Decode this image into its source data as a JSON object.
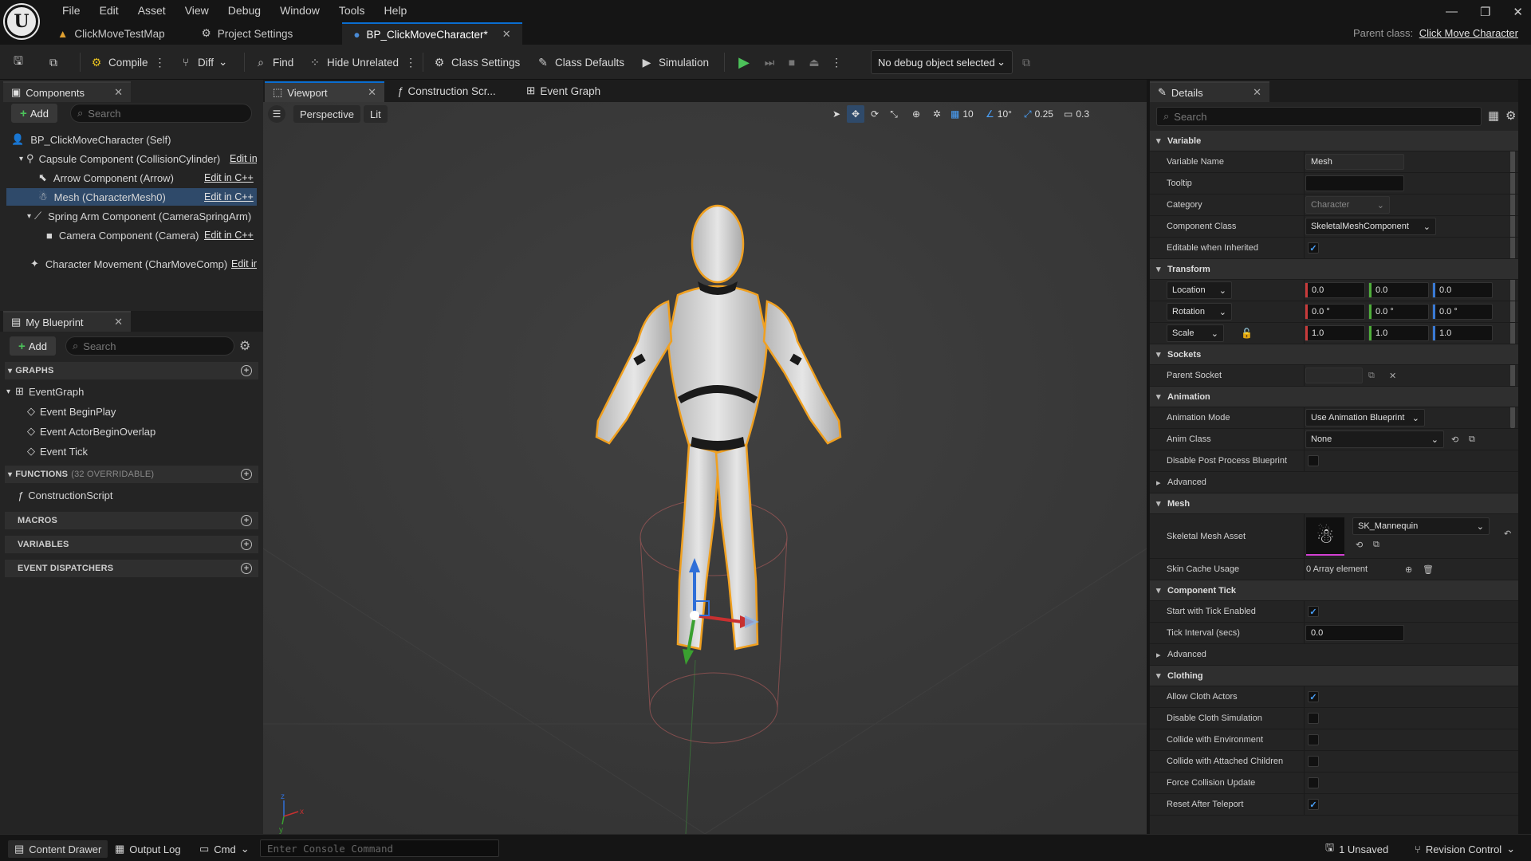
{
  "menu": [
    "File",
    "Edit",
    "Asset",
    "View",
    "Debug",
    "Window",
    "Tools",
    "Help"
  ],
  "tabs": [
    {
      "label": "ClickMoveTestMap",
      "icon": "map-icon"
    },
    {
      "label": "Project Settings",
      "icon": "settings-icon"
    },
    {
      "label": "BP_ClickMoveCharacter*",
      "icon": "blueprint-icon"
    }
  ],
  "parent_class": {
    "label": "Parent class:",
    "value": "Click Move Character"
  },
  "toolbar": {
    "compile": "Compile",
    "diff": "Diff",
    "find": "Find",
    "hide_unrelated": "Hide Unrelated",
    "class_settings": "Class Settings",
    "class_defaults": "Class Defaults",
    "simulation": "Simulation",
    "debug_object": "No debug object selected"
  },
  "components": {
    "tab": "Components",
    "add": "Add",
    "search_placeholder": "Search",
    "items": [
      {
        "label": "BP_ClickMoveCharacter (Self)",
        "edit": ""
      },
      {
        "label": "Capsule Component (CollisionCylinder)",
        "edit": "Edit in C++"
      },
      {
        "label": "Arrow Component (Arrow)",
        "edit": "Edit in C++"
      },
      {
        "label": "Mesh (CharacterMesh0)",
        "edit": "Edit in C++"
      },
      {
        "label": "Spring Arm Component (CameraSpringArm)",
        "edit": ""
      },
      {
        "label": "Camera Component (Camera)",
        "edit": "Edit in C++"
      },
      {
        "label": "Character Movement (CharMoveComp)",
        "edit": "Edit in C++"
      }
    ]
  },
  "my_blueprint": {
    "tab": "My Blueprint",
    "add": "Add",
    "search_placeholder": "Search",
    "graphs": "GRAPHS",
    "event_graph": "EventGraph",
    "events": [
      "Event BeginPlay",
      "Event ActorBeginOverlap",
      "Event Tick"
    ],
    "functions": "FUNCTIONS",
    "functions_count": "(32 OVERRIDABLE)",
    "construction_script": "ConstructionScript",
    "macros": "MACROS",
    "variables": "VARIABLES",
    "event_dispatchers": "EVENT DISPATCHERS"
  },
  "editor_tabs": {
    "viewport": "Viewport",
    "construction": "Construction Scr...",
    "event_graph": "Event Graph"
  },
  "viewport": {
    "perspective": "Perspective",
    "lit": "Lit",
    "grid_snap": "10",
    "rotation_snap": "10°",
    "scale_snap": "0.25",
    "camera_speed": "0.3"
  },
  "details": {
    "tab": "Details",
    "search_placeholder": "Search",
    "variable": {
      "section": "Variable",
      "name_label": "Variable Name",
      "name_value": "Mesh",
      "tooltip_label": "Tooltip",
      "category_label": "Category",
      "category_value": "Character",
      "class_label": "Component Class",
      "class_value": "SkeletalMeshComponent",
      "editable_label": "Editable when Inherited"
    },
    "transform": {
      "section": "Transform",
      "location": "Location",
      "rotation": "Rotation",
      "scale": "Scale",
      "loc": [
        "0.0",
        "0.0",
        "0.0"
      ],
      "rot": [
        "0.0 °",
        "0.0 °",
        "0.0 °"
      ],
      "scl": [
        "1.0",
        "1.0",
        "1.0"
      ]
    },
    "sockets": {
      "section": "Sockets",
      "parent_socket": "Parent Socket"
    },
    "animation": {
      "section": "Animation",
      "mode_label": "Animation Mode",
      "mode_value": "Use Animation Blueprint",
      "class_label": "Anim Class",
      "class_value": "None",
      "disable_pp": "Disable Post Process Blueprint",
      "advanced": "Advanced"
    },
    "mesh": {
      "section": "Mesh",
      "asset_label": "Skeletal Mesh Asset",
      "asset_value": "SK_Mannequin",
      "skin_cache": "Skin Cache Usage",
      "skin_cache_value": "0 Array element"
    },
    "tick": {
      "section": "Component Tick",
      "start": "Start with Tick Enabled",
      "interval": "Tick Interval (secs)",
      "interval_value": "0.0",
      "advanced": "Advanced"
    },
    "clothing": {
      "section": "Clothing",
      "allow": "Allow Cloth Actors",
      "disable": "Disable Cloth Simulation",
      "collide_env": "Collide with Environment",
      "collide_children": "Collide with Attached Children",
      "force": "Force Collision Update",
      "reset": "Reset After Teleport"
    }
  },
  "statusbar": {
    "content_drawer": "Content Drawer",
    "output_log": "Output Log",
    "cmd": "Cmd",
    "console_placeholder": "Enter Console Command",
    "unsaved": "1 Unsaved",
    "revision": "Revision Control"
  }
}
